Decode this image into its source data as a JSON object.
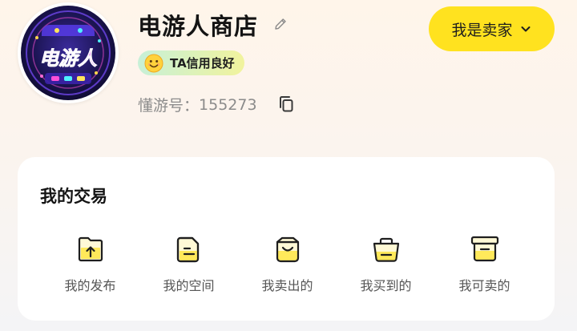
{
  "profile": {
    "avatar_text": "电游人",
    "name": "电游人商店",
    "credit_badge": "TA信用良好",
    "id_label": "懂游号：",
    "id_value": "155273"
  },
  "seller_button": {
    "label": "我是卖家"
  },
  "trade_section": {
    "title": "我的交易",
    "items": [
      {
        "label": "我的发布",
        "icon": "folder-upload-icon"
      },
      {
        "label": "我的空间",
        "icon": "document-icon"
      },
      {
        "label": "我卖出的",
        "icon": "shopping-bag-icon"
      },
      {
        "label": "我买到的",
        "icon": "basket-icon"
      },
      {
        "label": "我可卖的",
        "icon": "storage-box-icon"
      }
    ]
  },
  "colors": {
    "accent_yellow": "#ffe21f",
    "badge_gradient_start": "#c7f0d8",
    "badge_gradient_end": "#f1f39d",
    "icon_stroke": "#1f1f1f",
    "icon_fill_yellow": "#ffe95a"
  }
}
